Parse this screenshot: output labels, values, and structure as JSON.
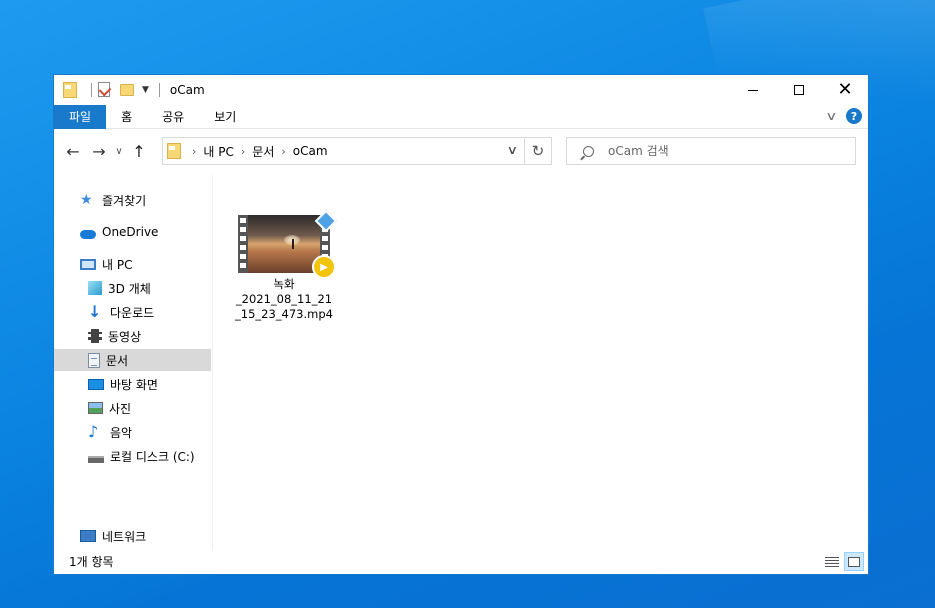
{
  "window": {
    "title": "oCam",
    "controls": {
      "minimize": "minimize-icon",
      "maximize": "maximize-icon",
      "close": "close-icon"
    }
  },
  "ribbon": {
    "tabs": [
      "파일",
      "홈",
      "공유",
      "보기"
    ],
    "help_label": "?"
  },
  "nav": {
    "breadcrumb": [
      "내 PC",
      "문서",
      "oCam"
    ],
    "search_placeholder": "oCam 검색"
  },
  "sidebar": {
    "quick_access": "즐겨찾기",
    "onedrive": "OneDrive",
    "this_pc": "내 PC",
    "pc_items": [
      "3D 개체",
      "다운로드",
      "동영상",
      "문서",
      "바탕 화면",
      "사진",
      "음악",
      "로컬 디스크 (C:)"
    ],
    "selected": "문서",
    "network": "네트워크"
  },
  "files": [
    {
      "name": "녹화_2021_08_11_21_15_23_473.mp4",
      "name_lines": [
        "녹화",
        "_2021_08_11_21",
        "_15_23_473.mp4"
      ],
      "type": "video"
    }
  ],
  "status": {
    "item_count": "1개 항목"
  },
  "colors": {
    "accent": "#1979ca",
    "selection": "#d9d9d9",
    "desktop": "#0a84e0"
  }
}
